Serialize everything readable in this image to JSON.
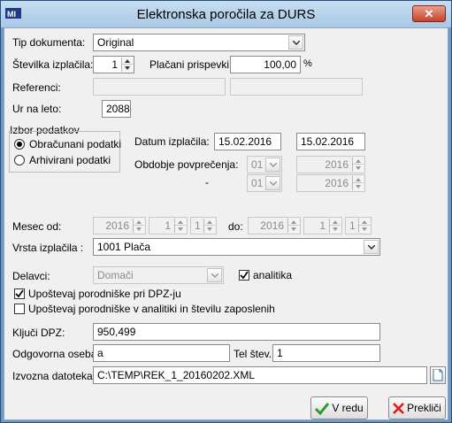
{
  "window": {
    "title": "Elektronska poročila za DURS",
    "close_glyph": "✕"
  },
  "form": {
    "tip_dokumenta": {
      "label": "Tip dokumenta:",
      "value": "Original"
    },
    "stevilka_izplacila": {
      "label": "Številka izplačila:",
      "value": "1"
    },
    "placani_prispevki": {
      "label": "Plačani prispevki :",
      "value": "100,00",
      "unit": "%"
    },
    "referenci": {
      "label": "Referenci:"
    },
    "ur_na_leto": {
      "label": "Ur na leto:",
      "value": "2088"
    },
    "izbor_podatkov": {
      "label": "Izbor podatkov",
      "options": [
        "Obračunani podatki",
        "Arhivirani podatki"
      ],
      "selected": "Obračunani podatki"
    },
    "datum_izplacila": {
      "label": "Datum izplačila:",
      "value1": "15.02.2016",
      "value2": "15.02.2016"
    },
    "obdobje": {
      "label": "Obdobje povprečenja:",
      "dash": "-",
      "month_from": "01",
      "year_from": "2016",
      "month_to": "01",
      "year_to": "2016"
    },
    "mesec_od": {
      "label": "Mesec od:",
      "year": "2016",
      "a": "1",
      "b": "1"
    },
    "mesec_do": {
      "label": "do:",
      "year": "2016",
      "a": "1",
      "b": "1"
    },
    "vrsta_izplacila": {
      "label": "Vrsta izplačila :",
      "value": "1001 Plača"
    },
    "delavci": {
      "label": "Delavci:",
      "value": "Domači"
    },
    "analitika": {
      "label": "analitika",
      "checked": true
    },
    "upostevaj_dpz": {
      "label": "Upoštevaj porodniške pri DPZ-ju",
      "checked": true
    },
    "upostevaj_analitika": {
      "label": "Upoštevaj porodniške v analitiki in številu zaposlenih",
      "checked": false
    },
    "kljuc_dpz": {
      "label": "Ključi DPZ:",
      "value": "950,499"
    },
    "odgovorna_oseba": {
      "label": "Odgovorna oseba:",
      "value": "a"
    },
    "tel_stev": {
      "label": "Tel štev.:",
      "value": "1"
    },
    "izvozna_datoteka": {
      "label": "Izvozna datoteka:",
      "value": "C:\\TEMP\\REK_1_20160202.XML"
    }
  },
  "buttons": {
    "ok": "V redu",
    "cancel": "Prekliči"
  },
  "colors": {
    "check_green": "#2e9b2e",
    "cancel_red": "#d22020",
    "title_bg": "#b6d1ea"
  }
}
